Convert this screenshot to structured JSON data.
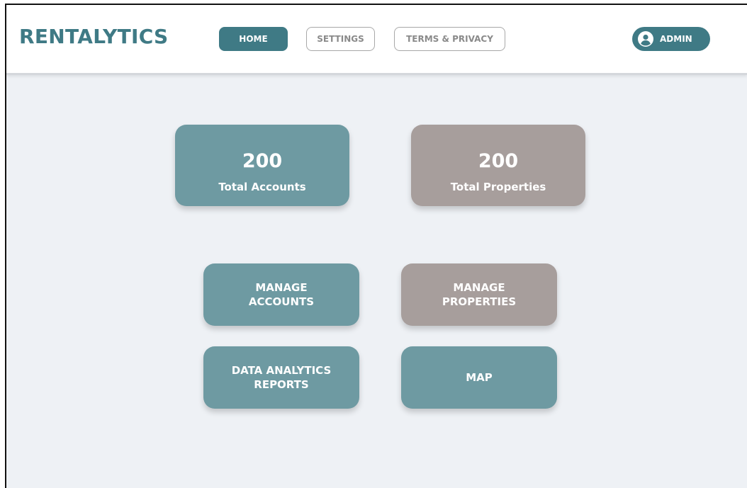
{
  "header": {
    "logo": "RENTALYTICS",
    "nav": {
      "home": "HOME",
      "settings": "SETTINGS",
      "terms": "TERMS & PRIVACY"
    },
    "user": {
      "label": "ADMIN",
      "icon": "user-circle-icon"
    }
  },
  "stats": {
    "accounts": {
      "value": "200",
      "label": "Total Accounts"
    },
    "properties": {
      "value": "200",
      "label": "Total Properties"
    }
  },
  "actions": {
    "manage_accounts": {
      "line1": "MANAGE",
      "line2": "ACCOUNTS"
    },
    "manage_properties": {
      "line1": "MANAGE",
      "line2": "PROPERTIES"
    },
    "reports": {
      "line1": "DATA ANALYTICS",
      "line2": "REPORTS"
    },
    "map": {
      "label": "MAP"
    }
  },
  "colors": {
    "primary": "#3f7a85",
    "teal_card": "#6e9aa2",
    "taupe_card": "#a79e9c",
    "background": "#eef1f5"
  }
}
